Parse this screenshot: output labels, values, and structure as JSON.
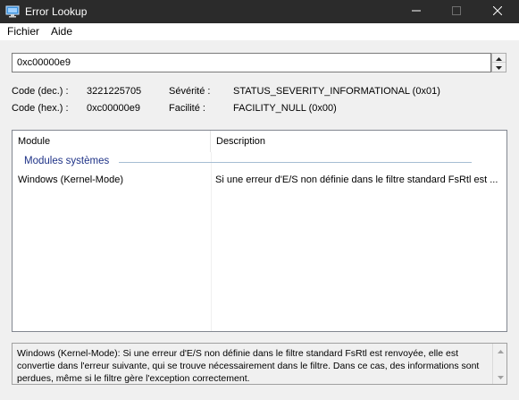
{
  "window": {
    "title": "Error Lookup"
  },
  "menu": {
    "file": "Fichier",
    "help": "Aide"
  },
  "input": {
    "value": "0xc00000e9"
  },
  "info": {
    "code_dec_label": "Code (dec.) :",
    "code_dec_value": "3221225705",
    "code_hex_label": "Code (hex.) :",
    "code_hex_value": "0xc00000e9",
    "severity_label": "Sévérité :",
    "severity_value": "STATUS_SEVERITY_INFORMATIONAL (0x01)",
    "facility_label": "Facilité :",
    "facility_value": "FACILITY_NULL (0x00)"
  },
  "list": {
    "headers": {
      "module": "Module",
      "description": "Description"
    },
    "group": "Modules systèmes",
    "rows": [
      {
        "module": "Windows (Kernel-Mode)",
        "description": "Si une erreur d'E/S non définie dans le filtre standard FsRtl est ..."
      }
    ]
  },
  "details": {
    "text": "Windows (Kernel-Mode): Si une erreur d'E/S non définie dans le filtre standard FsRtl est renvoyée, elle est convertie dans l'erreur suivante, qui se trouve nécessairement dans le filtre. Dans ce cas, des informations sont perdues, même si le filtre gère l'exception correctement."
  },
  "icons": {
    "app": "monitor-icon",
    "minimize": "minimize-icon",
    "maximize": "maximize-icon",
    "close": "close-icon",
    "spin_up": "chevron-up-icon",
    "spin_down": "chevron-down-icon"
  },
  "colors": {
    "titlebar": "#2b2b2b",
    "group_label": "#1e3287",
    "group_line": "#a6bdd3",
    "window_bg": "#f0f0f0"
  }
}
